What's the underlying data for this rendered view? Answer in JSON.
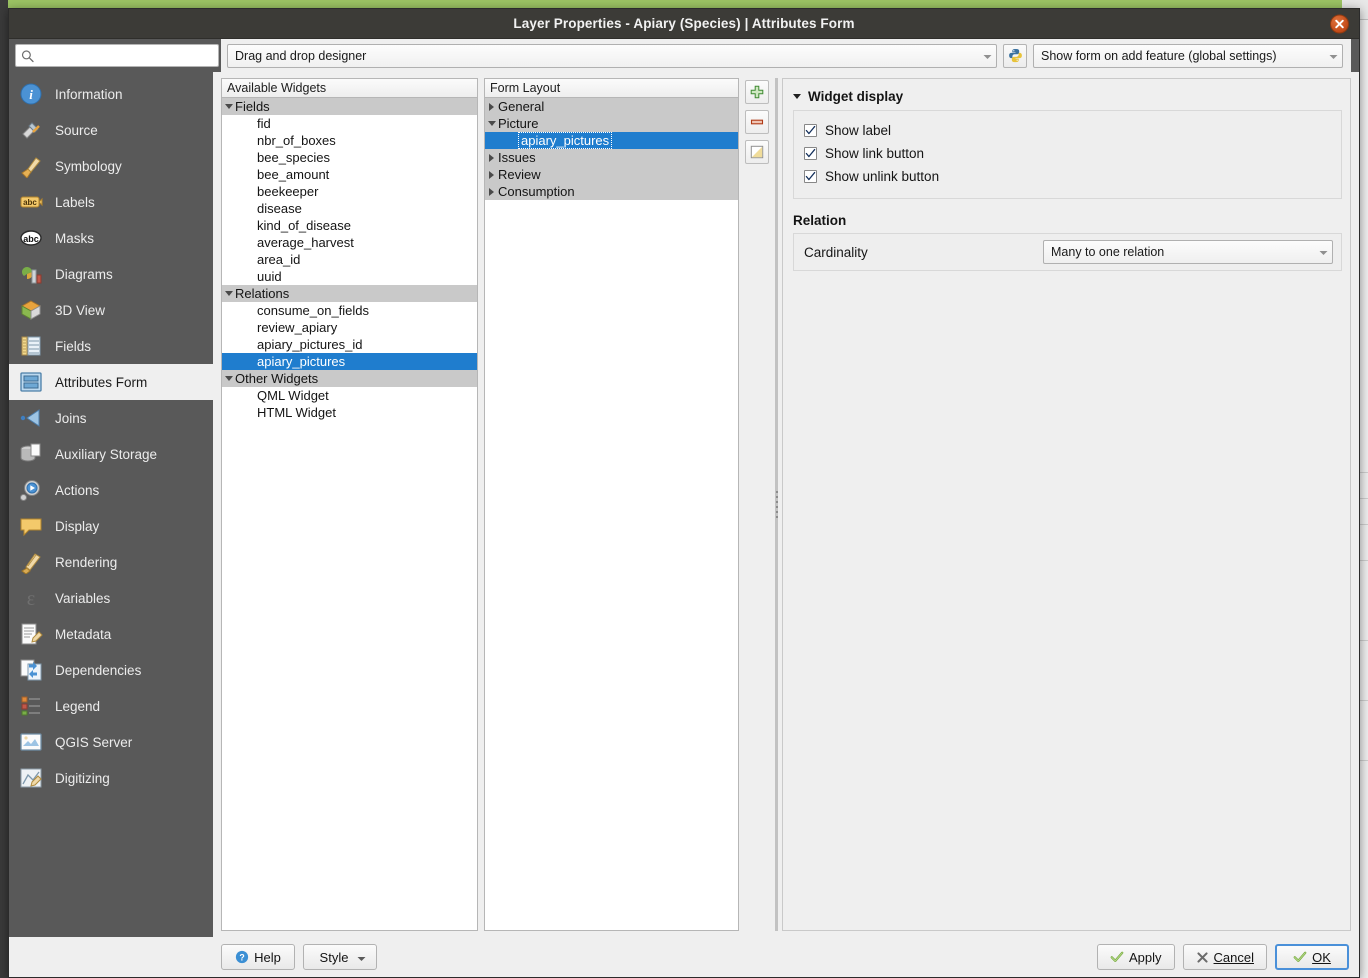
{
  "window": {
    "title": "Layer Properties - Apiary (Species) | Attributes Form",
    "close_label": "Close"
  },
  "toolbar": {
    "search_placeholder": "",
    "search_value": "",
    "search_icon": "search-icon",
    "designer_combo_value": "Drag and drop designer",
    "python_button_icon": "python-icon",
    "feature_combo_value": "Show form on add feature (global settings)"
  },
  "sidebar": {
    "items": [
      {
        "label": "Information",
        "icon": "information-icon",
        "active": false
      },
      {
        "label": "Source",
        "icon": "source-icon",
        "active": false
      },
      {
        "label": "Symbology",
        "icon": "symbology-icon",
        "active": false
      },
      {
        "label": "Labels",
        "icon": "labels-icon",
        "active": false
      },
      {
        "label": "Masks",
        "icon": "masks-icon",
        "active": false
      },
      {
        "label": "Diagrams",
        "icon": "diagrams-icon",
        "active": false
      },
      {
        "label": "3D View",
        "icon": "3d-view-icon",
        "active": false
      },
      {
        "label": "Fields",
        "icon": "fields-icon",
        "active": false
      },
      {
        "label": "Attributes Form",
        "icon": "attributes-form-icon",
        "active": true
      },
      {
        "label": "Joins",
        "icon": "joins-icon",
        "active": false
      },
      {
        "label": "Auxiliary Storage",
        "icon": "auxiliary-storage-icon",
        "active": false
      },
      {
        "label": "Actions",
        "icon": "actions-icon",
        "active": false
      },
      {
        "label": "Display",
        "icon": "display-icon",
        "active": false
      },
      {
        "label": "Rendering",
        "icon": "rendering-icon",
        "active": false
      },
      {
        "label": "Variables",
        "icon": "variables-icon",
        "active": false
      },
      {
        "label": "Metadata",
        "icon": "metadata-icon",
        "active": false
      },
      {
        "label": "Dependencies",
        "icon": "dependencies-icon",
        "active": false
      },
      {
        "label": "Legend",
        "icon": "legend-icon",
        "active": false
      },
      {
        "label": "QGIS Server",
        "icon": "qgis-server-icon",
        "active": false
      },
      {
        "label": "Digitizing",
        "icon": "digitizing-icon",
        "active": false
      }
    ]
  },
  "available_widgets": {
    "header": "Available Widgets",
    "nodes": [
      {
        "label": "Fields",
        "level": 1,
        "type": "group",
        "expanded": true
      },
      {
        "label": "fid",
        "level": 2,
        "type": "item"
      },
      {
        "label": "nbr_of_boxes",
        "level": 2,
        "type": "item"
      },
      {
        "label": "bee_species",
        "level": 2,
        "type": "item"
      },
      {
        "label": "bee_amount",
        "level": 2,
        "type": "item"
      },
      {
        "label": "beekeeper",
        "level": 2,
        "type": "item"
      },
      {
        "label": "disease",
        "level": 2,
        "type": "item"
      },
      {
        "label": "kind_of_disease",
        "level": 2,
        "type": "item"
      },
      {
        "label": "average_harvest",
        "level": 2,
        "type": "item"
      },
      {
        "label": "area_id",
        "level": 2,
        "type": "item"
      },
      {
        "label": "uuid",
        "level": 2,
        "type": "item"
      },
      {
        "label": "Relations",
        "level": 1,
        "type": "group",
        "expanded": true
      },
      {
        "label": "consume_on_fields",
        "level": 2,
        "type": "item"
      },
      {
        "label": "review_apiary",
        "level": 2,
        "type": "item"
      },
      {
        "label": "apiary_pictures_id",
        "level": 2,
        "type": "item"
      },
      {
        "label": "apiary_pictures",
        "level": 2,
        "type": "item",
        "selected": true
      },
      {
        "label": "Other Widgets",
        "level": 1,
        "type": "group",
        "expanded": true
      },
      {
        "label": "QML Widget",
        "level": 2,
        "type": "item"
      },
      {
        "label": "HTML Widget",
        "level": 2,
        "type": "item"
      }
    ]
  },
  "form_layout": {
    "header": "Form Layout",
    "nodes": [
      {
        "label": "General",
        "level": 1,
        "type": "group",
        "expanded": false
      },
      {
        "label": "Picture",
        "level": 1,
        "type": "group",
        "expanded": true
      },
      {
        "label": "apiary_pictures",
        "level": 2,
        "type": "item",
        "selected": true
      },
      {
        "label": "Issues",
        "level": 1,
        "type": "group",
        "expanded": false
      },
      {
        "label": "Review",
        "level": 1,
        "type": "group",
        "expanded": false
      },
      {
        "label": "Consumption",
        "level": 1,
        "type": "group",
        "expanded": false
      }
    ],
    "tools": [
      {
        "name": "add-container-button",
        "icon": "plus-icon",
        "title": "Add"
      },
      {
        "name": "remove-item-button",
        "icon": "minus-icon",
        "title": "Remove"
      },
      {
        "name": "invert-selection-button",
        "icon": "invert-icon",
        "title": "Invert"
      }
    ]
  },
  "properties": {
    "widget_display": {
      "title": "Widget display",
      "expanded": true,
      "checkboxes": [
        {
          "label": "Show label",
          "checked": true
        },
        {
          "label": "Show link button",
          "checked": true
        },
        {
          "label": "Show unlink button",
          "checked": true
        }
      ]
    },
    "relation": {
      "title": "Relation",
      "cardinality_label": "Cardinality",
      "cardinality_value": "Many to one relation"
    }
  },
  "buttons": {
    "help": "Help",
    "style": "Style",
    "apply": "Apply",
    "cancel": "Cancel",
    "ok": "OK"
  },
  "colors": {
    "selection_blue": "#1f7dce",
    "sidebar_bg": "#595959",
    "titlebar_bg": "#3c3b37",
    "dialog_bg": "#efefef",
    "group_row_bg": "#c9c9c9",
    "close_button": "#c24a18",
    "default_button_border": "#4a90d9"
  }
}
